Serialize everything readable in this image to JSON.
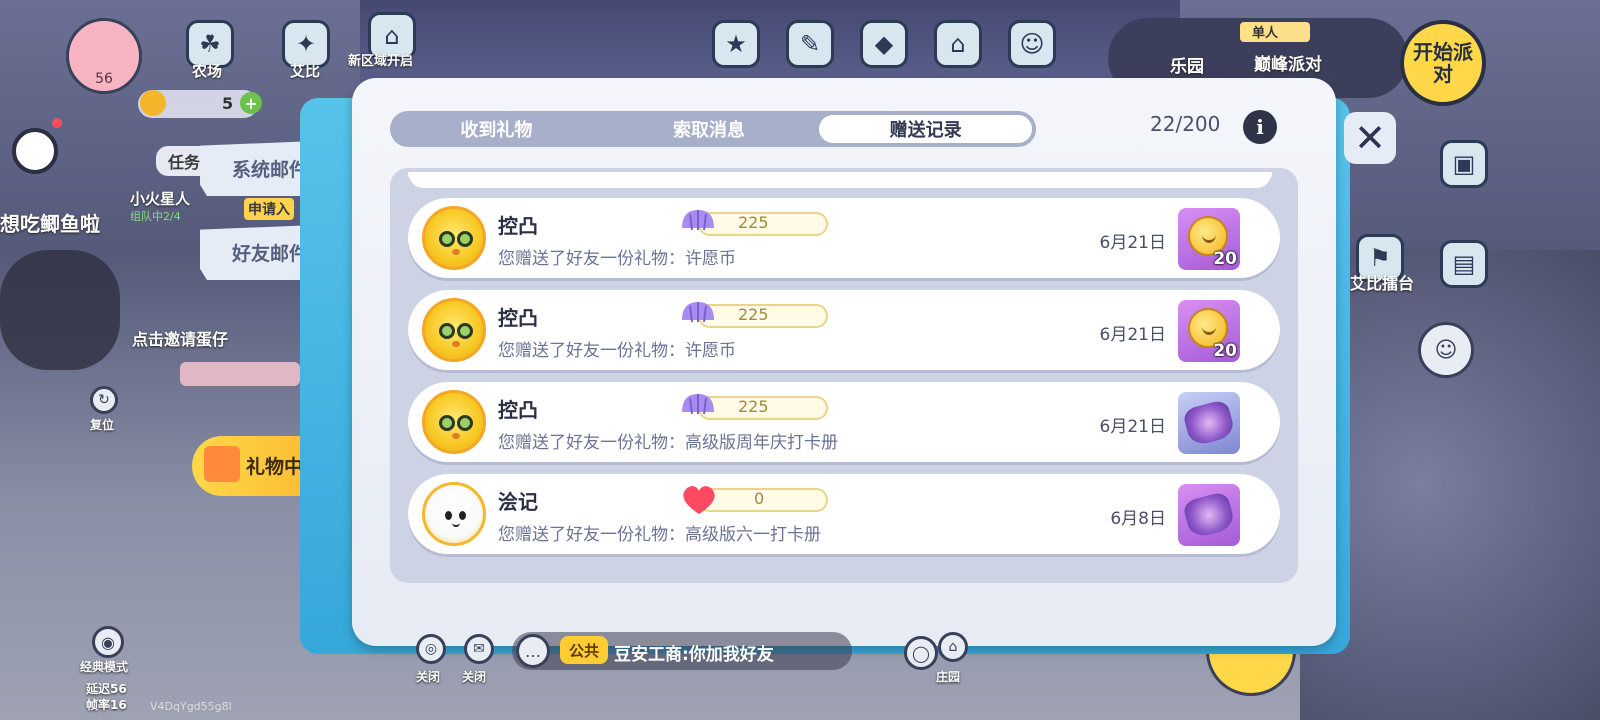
{
  "hud": {
    "avatar_level": "56",
    "farm": "农场",
    "aibi": "艾比",
    "new_area": "新区域开启",
    "coins": "5",
    "task": "任务",
    "player_name": "小火星人",
    "player_status": "组队中2/4",
    "apply": "申请入",
    "chat_bubble": "想吃鲫鱼啦",
    "invite": "点击邀请蛋仔",
    "reset": "复位",
    "classic_mode": "经典模式",
    "latency": "延迟56",
    "fps": "帧率16",
    "device_id": "V4DqYgd55g8l",
    "top_icons": [
      "热销",
      "手册",
      "盲盒",
      "商城",
      "活动"
    ],
    "party_mode": "单人",
    "party_name": "巅峰派对",
    "party_tab": "乐园",
    "start_party": "开始派对",
    "arena": "艾比擂台",
    "gift_center": "礼物中心",
    "mute1": "关闭",
    "mute2": "关闭",
    "manor": "庄园"
  },
  "mail_tabs": {
    "system": "系统邮件",
    "friend": "好友邮件"
  },
  "dialog": {
    "tabs": [
      "收到礼物",
      "索取消息",
      "赠送记录"
    ],
    "active_tab": 2,
    "counter": "22/200",
    "info": "i",
    "close": "✕"
  },
  "records": [
    {
      "name": "控凸",
      "desc": "您赠送了好友一份礼物：许愿币",
      "currency_icon": "shell-icon",
      "currency_sub": "1",
      "value": "225",
      "date": "6月21日",
      "gift": "wish-coin",
      "qty": "20"
    },
    {
      "name": "控凸",
      "desc": "您赠送了好友一份礼物：许愿币",
      "currency_icon": "shell-icon",
      "currency_sub": "1",
      "value": "225",
      "date": "6月21日",
      "gift": "wish-coin",
      "qty": "20"
    },
    {
      "name": "控凸",
      "desc": "您赠送了好友一份礼物：高级版周年庆打卡册",
      "currency_icon": "shell-icon",
      "currency_sub": "1",
      "value": "225",
      "date": "6月21日",
      "gift": "anniversary-book",
      "qty": ""
    },
    {
      "name": "浍记",
      "desc": "您赠送了好友一份礼物：高级版六一打卡册",
      "currency_icon": "heart-icon",
      "currency_sub": "",
      "value": "0",
      "date": "6月8日",
      "gift": "children-day-book",
      "qty": ""
    }
  ],
  "chat": {
    "channel": "公共",
    "message": "豆安工商:你加我好友"
  },
  "colors": {
    "frame_blue": "#3fb2e0",
    "dialog_bg": "#f0f3f9",
    "tab_track": "#a8afcb",
    "gift_tile_purple": "#c77de9"
  }
}
